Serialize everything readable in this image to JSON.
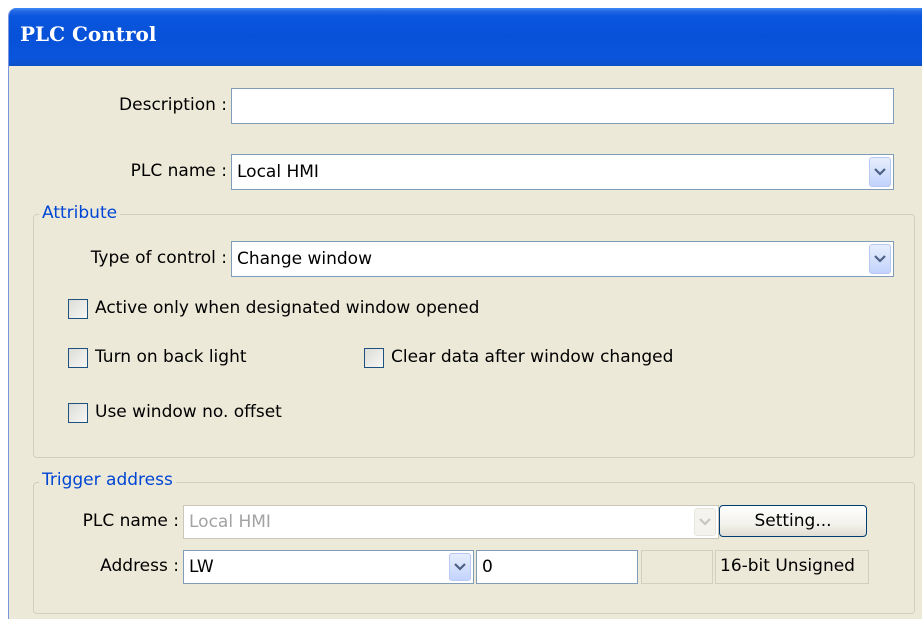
{
  "window": {
    "title": "PLC Control"
  },
  "general": {
    "description_label": "Description :",
    "description_value": "",
    "plc_name_label": "PLC name :",
    "plc_name_value": "Local HMI"
  },
  "attribute": {
    "legend": "Attribute",
    "type_label": "Type of control :",
    "type_value": "Change window",
    "checkboxes": {
      "active_only": {
        "label": "Active only when designated window opened",
        "checked": false
      },
      "back_light": {
        "label": "Turn on back light",
        "checked": false
      },
      "clear_data": {
        "label": "Clear data after window changed",
        "checked": false
      },
      "window_offset": {
        "label": "Use window no. offset",
        "checked": false
      }
    }
  },
  "trigger": {
    "legend": "Trigger address",
    "plc_name_label": "PLC name :",
    "plc_name_value": "Local HMI",
    "setting_button": "Setting...",
    "address_label": "Address :",
    "address_device": "LW",
    "address_value": "0",
    "data_format": "16-bit Unsigned"
  },
  "colors": {
    "title_bar": "#0651d8",
    "dialog_bg": "#ece9d8",
    "group_legend": "#0046d5"
  }
}
